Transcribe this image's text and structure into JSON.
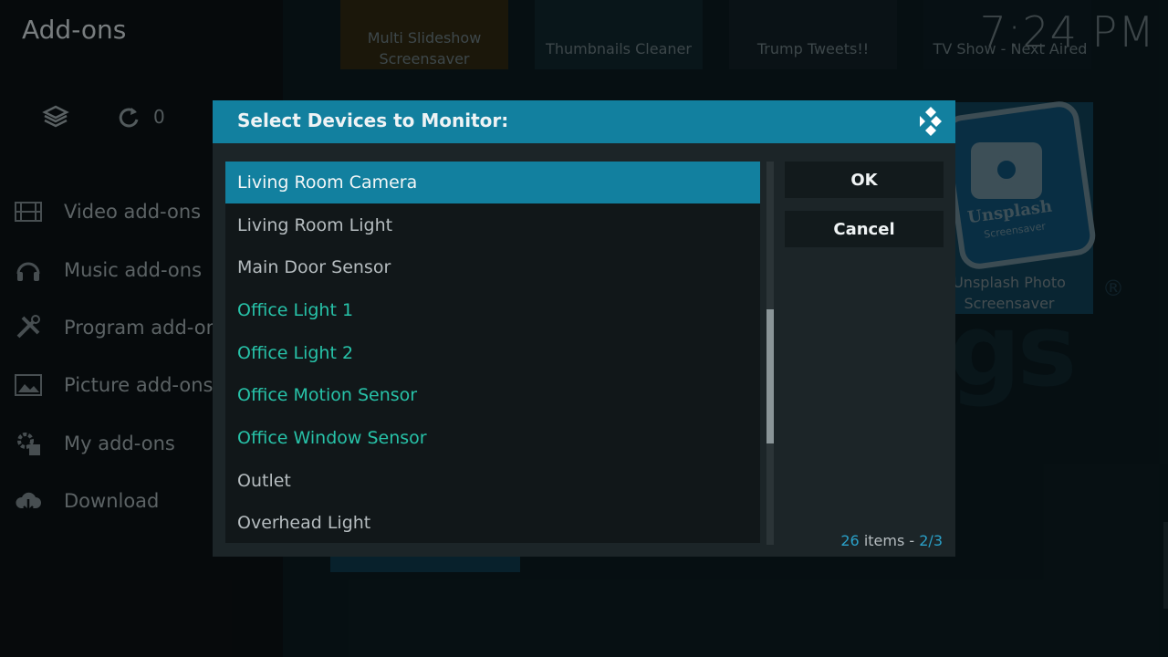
{
  "page": {
    "title": "Add-ons",
    "clock": "7:24 PM"
  },
  "top_icons": {
    "update_count": "0"
  },
  "side_menu": {
    "items": [
      {
        "label": "Video add-ons",
        "icon": "film-strip-icon"
      },
      {
        "label": "Music add-ons",
        "icon": "headphones-icon"
      },
      {
        "label": "Program add-ons",
        "icon": "tools-icon"
      },
      {
        "label": "Picture add-ons",
        "icon": "picture-icon"
      },
      {
        "label": "My add-ons",
        "icon": "gear-box-icon"
      },
      {
        "label": "Download",
        "icon": "cloud-download-icon"
      }
    ]
  },
  "background_tiles": {
    "items": [
      {
        "label_line1": "Multi Slideshow",
        "label_line2": "Screensaver"
      },
      {
        "label_line1": "Thumbnails Cleaner",
        "label_line2": ""
      },
      {
        "label_line1": "Trump Tweets!!",
        "label_line2": ""
      },
      {
        "label_line1": "TV Show - Next Aired",
        "label_line2": ""
      }
    ],
    "unsplash": {
      "art_text": "Unsplash",
      "art_sub": "Screensaver",
      "label_line1": "Unsplash Photo",
      "label_line2": "Screensaver"
    },
    "watermark": "gs",
    "registered_mark": "®"
  },
  "dialog": {
    "title": "Select Devices to Monitor:",
    "items": [
      {
        "label": "Living Room Camera",
        "state": "focused"
      },
      {
        "label": "Living Room Light",
        "state": "normal"
      },
      {
        "label": "Main Door Sensor",
        "state": "normal"
      },
      {
        "label": "Office Light 1",
        "state": "selected"
      },
      {
        "label": "Office Light 2",
        "state": "selected"
      },
      {
        "label": "Office Motion Sensor",
        "state": "selected"
      },
      {
        "label": "Office Window Sensor",
        "state": "selected"
      },
      {
        "label": "Outlet",
        "state": "normal"
      },
      {
        "label": "Overhead Light",
        "state": "normal"
      }
    ],
    "ok_label": "OK",
    "cancel_label": "Cancel",
    "count_number": "26",
    "count_word": " items - ",
    "page_indicator": "2/3",
    "scroll_position": 0.385,
    "scroll_visible_fraction": 0.35
  },
  "colors": {
    "accent": "#12809f",
    "selected_text": "#27c2a8",
    "count_highlight": "#2aa0c8"
  }
}
